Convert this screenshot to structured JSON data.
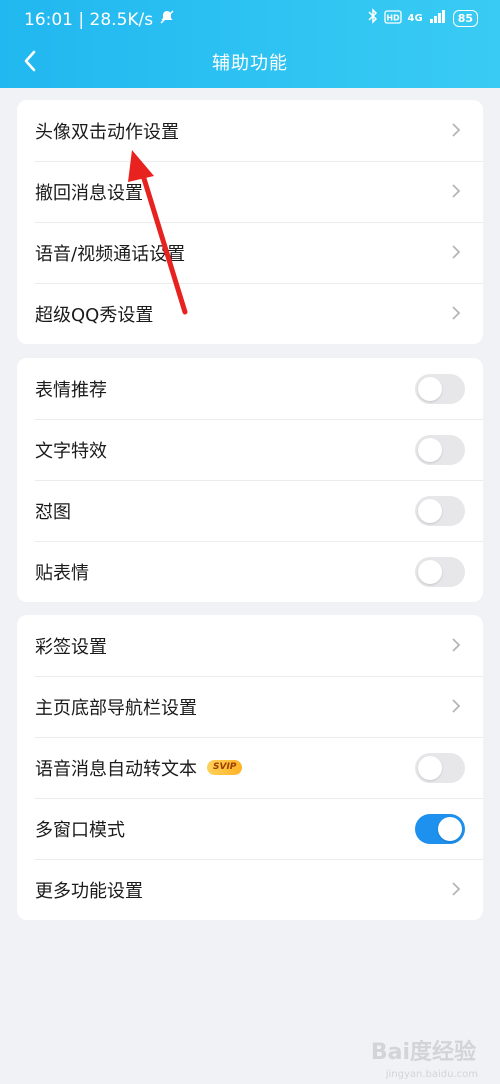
{
  "status_bar": {
    "time": "16:01",
    "network_speed": "28.5K/s",
    "network_type": "4G",
    "battery": "85"
  },
  "header": {
    "title": "辅助功能",
    "back_icon": "chevron-left-icon"
  },
  "sections": [
    {
      "items": [
        {
          "label": "头像双击动作设置",
          "control": "chevron"
        },
        {
          "label": "撤回消息设置",
          "control": "chevron"
        },
        {
          "label": "语音/视频通话设置",
          "control": "chevron"
        },
        {
          "label": "超级QQ秀设置",
          "control": "chevron"
        }
      ]
    },
    {
      "items": [
        {
          "label": "表情推荐",
          "control": "toggle",
          "on": false
        },
        {
          "label": "文字特效",
          "control": "toggle",
          "on": false
        },
        {
          "label": "怼图",
          "control": "toggle",
          "on": false
        },
        {
          "label": "贴表情",
          "control": "toggle",
          "on": false
        }
      ]
    },
    {
      "items": [
        {
          "label": "彩签设置",
          "control": "chevron"
        },
        {
          "label": "主页底部导航栏设置",
          "control": "chevron"
        },
        {
          "label": "语音消息自动转文本",
          "badge": "SVIP",
          "control": "toggle",
          "on": false
        },
        {
          "label": "多窗口模式",
          "control": "toggle",
          "on": true
        },
        {
          "label": "更多功能设置",
          "control": "chevron"
        }
      ]
    }
  ],
  "watermark": {
    "text": "Bai度经验",
    "sub": "jingyan.baidu.com"
  },
  "colors": {
    "header_start": "#21b7f0",
    "header_end": "#39cbf3",
    "toggle_on": "#1e90ee",
    "annotation_arrow": "#e8231f"
  }
}
